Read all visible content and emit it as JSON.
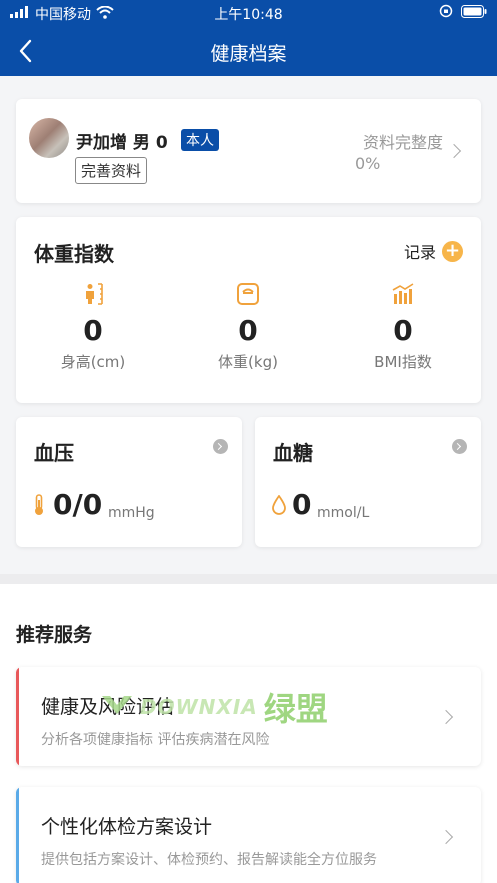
{
  "status_bar": {
    "carrier": "中国移动",
    "time": "上午10:48",
    "icons": [
      "signal-icon",
      "wifi-icon",
      "rotation-lock-icon",
      "battery-icon"
    ]
  },
  "nav": {
    "title": "健康档案",
    "back_icon": "back-arrow-icon"
  },
  "profile": {
    "name": "尹加增 男 0",
    "badge": "本人",
    "complete_button": "完善资料",
    "completeness_label": "资料完整度",
    "completeness_value": "0%"
  },
  "weight": {
    "title": "体重指数",
    "record_label": "记录",
    "metrics": [
      {
        "icon": "height-icon",
        "value": "0",
        "label": "身高(cm)"
      },
      {
        "icon": "scale-icon",
        "value": "0",
        "label": "体重(kg)"
      },
      {
        "icon": "bmi-chart-icon",
        "value": "0",
        "label": "BMI指数"
      }
    ]
  },
  "blood_pressure": {
    "title": "血压",
    "value": "0/0",
    "unit": "mmHg",
    "icon": "thermometer-icon"
  },
  "blood_sugar": {
    "title": "血糖",
    "value": "0",
    "unit": "mmol/L",
    "icon": "drop-icon"
  },
  "recommended": {
    "title": "推荐服务",
    "services": [
      {
        "title": "健康及风险评估",
        "subtitle": "分析各项健康指标 评估疾病潜在风险",
        "accent": "#e8585a"
      },
      {
        "title": "个性化体检方案设计",
        "subtitle": "提供包括方案设计、体检预约、报告解读能全方位服务",
        "accent": "#5aaae8"
      }
    ]
  },
  "watermark": {
    "en": "DOWNXIA",
    "cn": "绿盟"
  },
  "colors": {
    "brand": "#0a4ea8",
    "accent_orange": "#f7b54a",
    "red_accent": "#e8585a",
    "blue_accent": "#5aaae8"
  }
}
